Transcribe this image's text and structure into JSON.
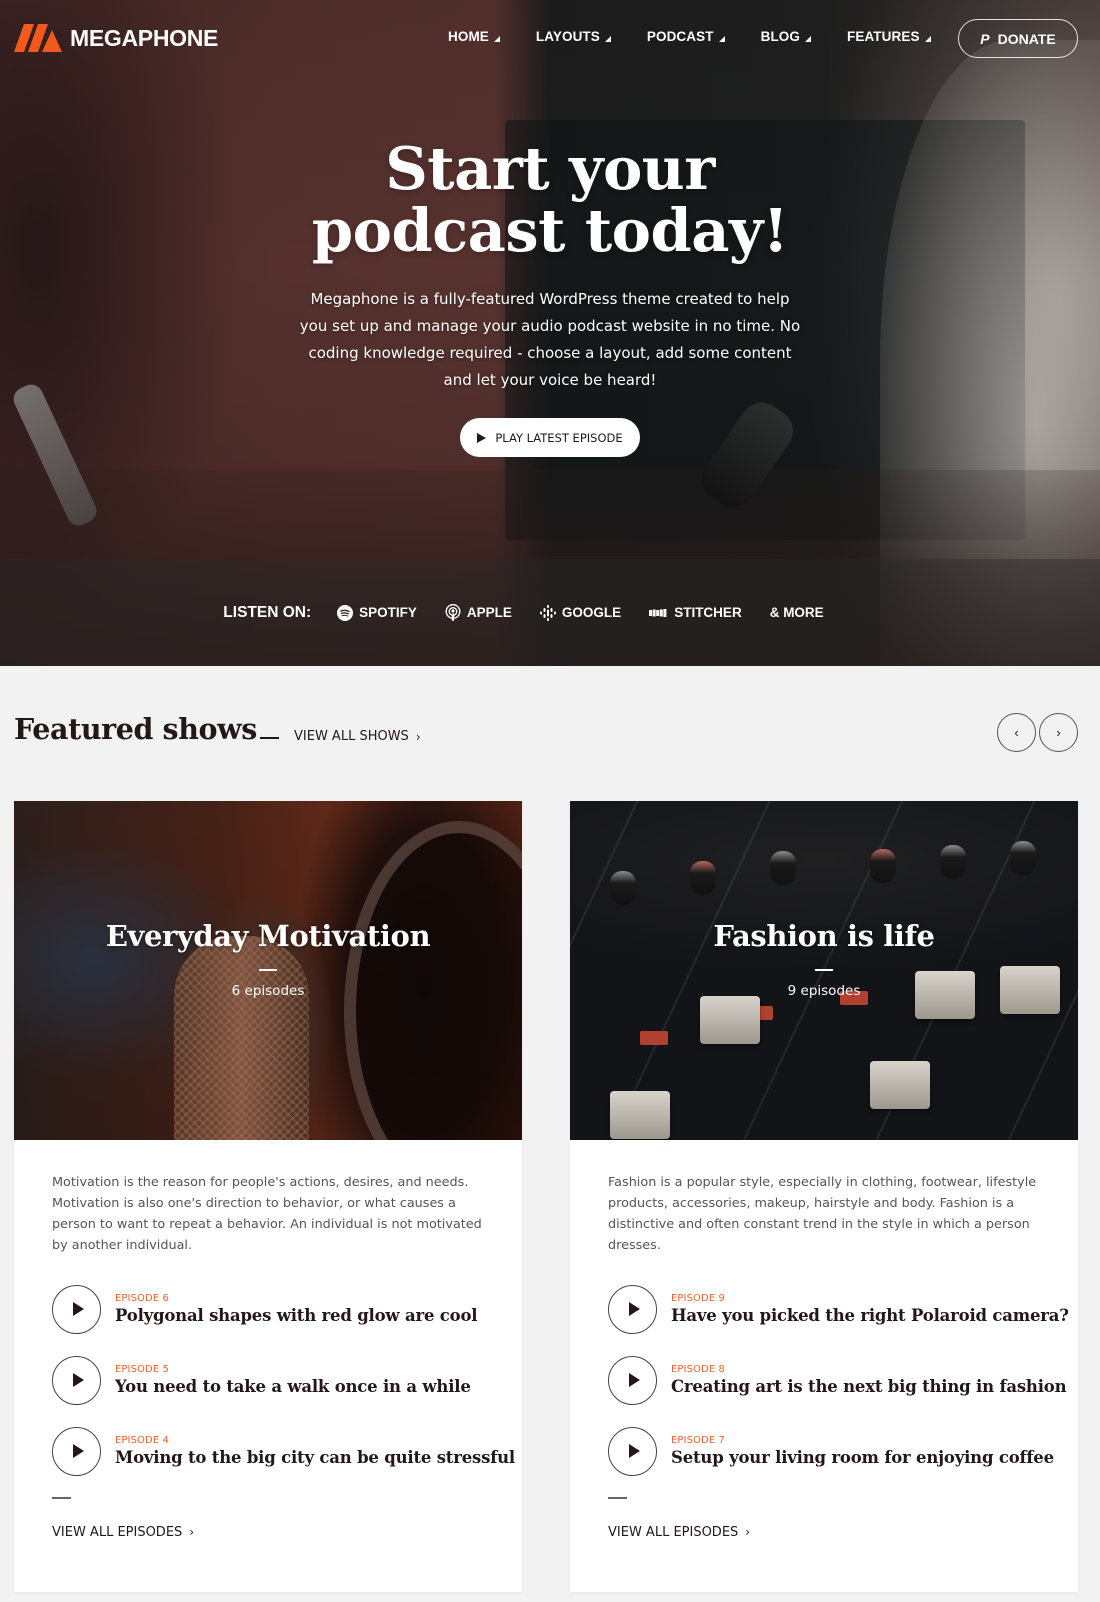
{
  "brand": {
    "name": "MEGAPHONE",
    "logo_icon": "megaphone-logo-stripes",
    "accent_color": "#f2591d"
  },
  "nav": {
    "items": [
      {
        "label": "HOME",
        "has_dropdown": true
      },
      {
        "label": "LAYOUTS",
        "has_dropdown": true
      },
      {
        "label": "PODCAST",
        "has_dropdown": true
      },
      {
        "label": "BLOG",
        "has_dropdown": true
      },
      {
        "label": "FEATURES",
        "has_dropdown": true
      }
    ],
    "donate": {
      "label": "DONATE",
      "icon": "paypal-icon"
    }
  },
  "hero": {
    "title_line1": "Start your",
    "title_line2": "podcast today!",
    "description": "Megaphone is a fully-featured WordPress theme created to help you set up and manage your audio podcast website in no time. No coding knowledge required - choose a layout, add some content and let your voice be heard!",
    "cta_label": "PLAY LATEST EPISODE"
  },
  "listen_on": {
    "label": "LISTEN ON:",
    "platforms": [
      {
        "label": "SPOTIFY",
        "icon": "spotify-icon"
      },
      {
        "label": "APPLE",
        "icon": "apple-podcasts-icon"
      },
      {
        "label": "GOOGLE",
        "icon": "google-podcasts-icon"
      },
      {
        "label": "STITCHER",
        "icon": "stitcher-icon"
      },
      {
        "label": "& MORE",
        "icon": null
      }
    ]
  },
  "featured": {
    "title": "Featured shows",
    "view_all_label": "VIEW ALL SHOWS",
    "prev_label": "‹",
    "next_label": "›",
    "shows": [
      {
        "title": "Everyday Motivation",
        "episode_count": "6 episodes",
        "description": "Motivation is the reason for people's actions, desires, and needs. Motivation is also one's direction to behavior, or what causes a person to want to repeat a behavior. An individual is not motivated by another individual.",
        "episodes": [
          {
            "number": "EPISODE 6",
            "title": "Polygonal shapes with red glow are cool"
          },
          {
            "number": "EPISODE 5",
            "title": "You need to take a walk once in a while"
          },
          {
            "number": "EPISODE 4",
            "title": "Moving to the big city can be quite stressful"
          }
        ],
        "view_all_label": "VIEW ALL EPISODES"
      },
      {
        "title": "Fashion is life",
        "episode_count": "9 episodes",
        "description": "Fashion is a popular style, especially in clothing, footwear, lifestyle products, accessories, makeup, hairstyle and body. Fashion is a distinctive and often constant trend in the style in which a person dresses.",
        "episodes": [
          {
            "number": "EPISODE 9",
            "title": "Have you picked the right Polaroid camera?"
          },
          {
            "number": "EPISODE 8",
            "title": "Creating art is the next big thing in fashion"
          },
          {
            "number": "EPISODE 7",
            "title": "Setup your living room for enjoying coffee"
          }
        ],
        "view_all_label": "VIEW ALL EPISODES"
      }
    ]
  },
  "colors": {
    "episode_number": "#e8622c",
    "text_dark": "#231717",
    "page_background": "#f2f2f2"
  }
}
